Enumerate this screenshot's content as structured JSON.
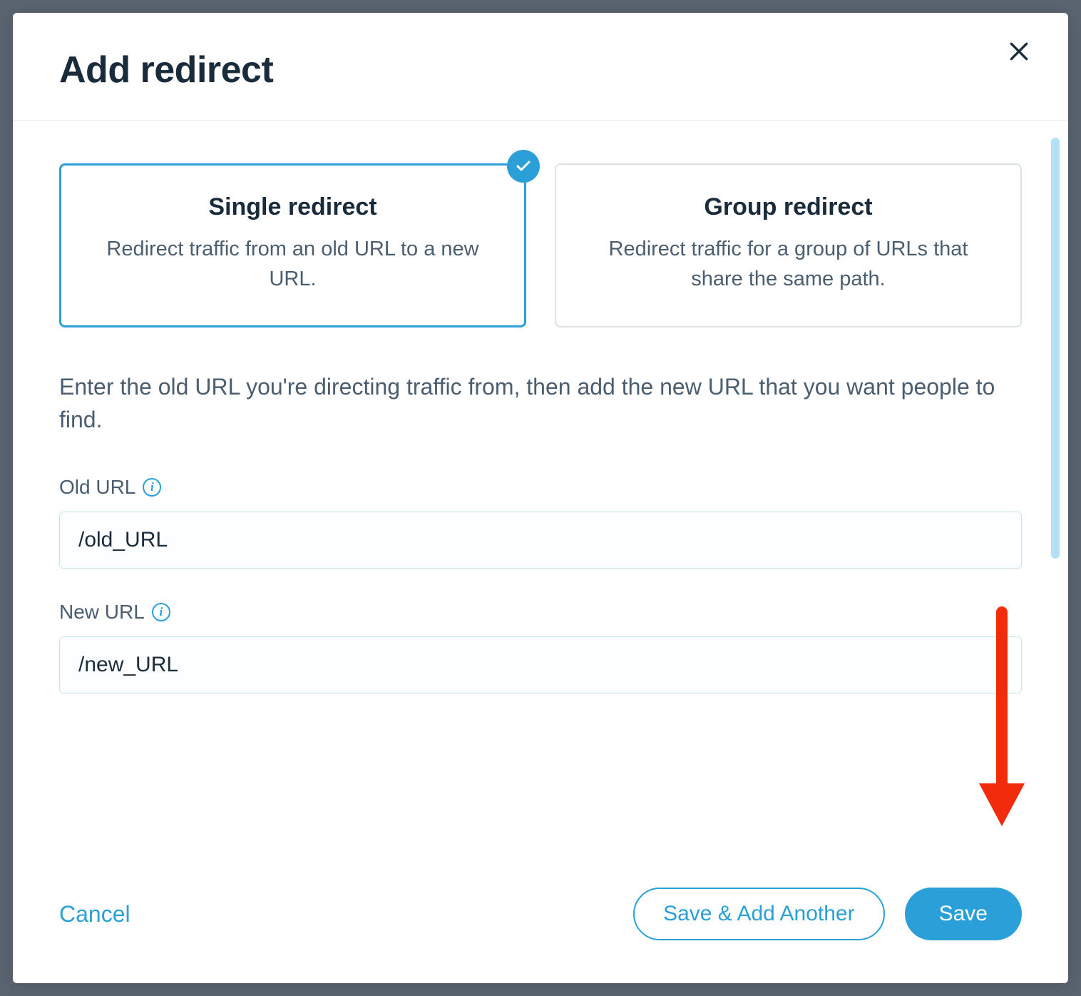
{
  "modal": {
    "title": "Add redirect",
    "close_icon": "close"
  },
  "options": {
    "single": {
      "title": "Single redirect",
      "description": "Redirect traffic from an old URL to a new URL.",
      "selected": true
    },
    "group": {
      "title": "Group redirect",
      "description": "Redirect traffic for a group of URLs that share the same path.",
      "selected": false
    }
  },
  "instruction": "Enter the old URL you're directing traffic from, then add the new URL that you want people to find.",
  "form": {
    "old_url": {
      "label": "Old URL",
      "value": "/old_URL"
    },
    "new_url": {
      "label": "New URL",
      "value": "/new_URL"
    }
  },
  "buttons": {
    "cancel": "Cancel",
    "save_another": "Save & Add Another",
    "save": "Save"
  },
  "colors": {
    "accent": "#2a9fd8",
    "text_primary": "#1a2b3c",
    "text_secondary": "#4a5e70",
    "annotation": "#f22b0b"
  }
}
